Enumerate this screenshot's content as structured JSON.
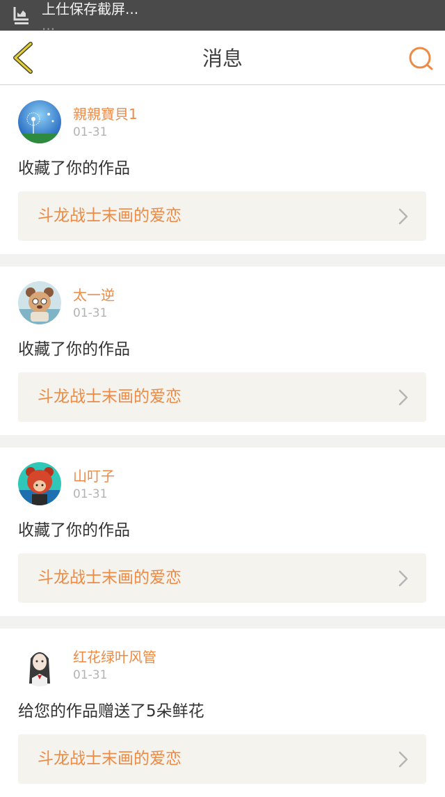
{
  "status_bar": {
    "notification_text": "上仕保存截屏...",
    "notification_subtext": "···"
  },
  "nav": {
    "title": "消息",
    "back_icon": "back-chevron-icon",
    "search_icon": "search-icon",
    "accent_color": "#ee8a44",
    "back_color": "#e5cf3a"
  },
  "messages": [
    {
      "username": "親親寶貝1",
      "date": "01-31",
      "action": "收藏了你的作品",
      "work_title": "斗龙战士末画的爱恋",
      "avatar": "dandelion-avatar"
    },
    {
      "username": "太一逆",
      "date": "01-31",
      "action": "收藏了你的作品",
      "work_title": "斗龙战士末画的爱恋",
      "avatar": "cartoon-bear-avatar"
    },
    {
      "username": "山叮子",
      "date": "01-31",
      "action": "收藏了你的作品",
      "work_title": "斗龙战士末画的爱恋",
      "avatar": "red-bear-costume-avatar"
    },
    {
      "username": "红花绿叶风管",
      "date": "01-31",
      "action": "给您的作品赠送了5朵鲜花",
      "work_title": "斗龙战士末画的爱恋",
      "avatar": "anime-girl-avatar"
    }
  ]
}
